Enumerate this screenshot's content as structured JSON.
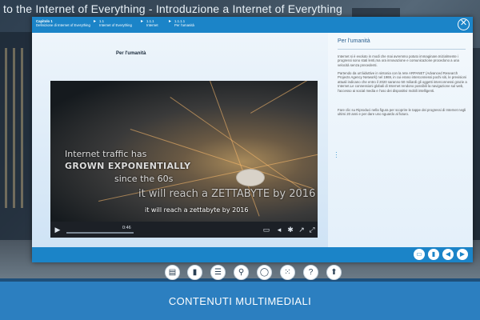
{
  "page": {
    "title": "to the Internet of Everything - Introduzione a Internet of Everything"
  },
  "breadcrumb": [
    {
      "line1": "Capitolo 1",
      "line2": "Definizione di Internet of Everything"
    },
    {
      "line1": "1.1",
      "line2": "Internet of Everything"
    },
    {
      "line1": "1.1.1",
      "line2": "Internet"
    },
    {
      "line1": "1.1.1.1",
      "line2": "Per l'umanità"
    }
  ],
  "left": {
    "section_label": "Per l'umanità"
  },
  "video": {
    "overlay_line1": "Internet traffic has",
    "overlay_line2": "GROWN EXPONENTIALLY",
    "overlay_line3": "since the 60s",
    "overlay_line4": "it will reach a ZETTABYTE by 2016",
    "caption": "it will reach a zettabyte by 2016",
    "time": "0:46"
  },
  "right": {
    "title": "Per l'umanità",
    "paragraphs": [
      "Internet si è evoluto in modi che mai avremmo potuto immaginare.Inizialmente i progressi sono stati lenti,ma ora innovazione e comunicazione procedono a una velocità senza precedenti.",
      "Partendo da un'àiduttive in sintonia con la rete ARPANET (Advanced Research Projects Agency Network) nel 1969, in cui erano interconnessi pochi siti, le previsioni attuali indicano che entro il 2020 saranno 50 miliardi gli oggetti interconnessi grazie a Internet.Le connessioni globali di Internet rendono possibili la navigazione sul web, l'accesso ai social media e l'uso dei dispositivi mobili intelligenti.",
      "Fare clic su Riproduci nella figura per scoprire le tappe dei progressi di Internet negli ultimi 20 anni e per dare uno sguardo al futuro."
    ]
  },
  "toolbar_icons": [
    "book-icon",
    "bookmark-icon",
    "list-icon",
    "search-icon",
    "chat-icon",
    "grid-icon",
    "help-icon",
    "upload-icon"
  ],
  "banner": {
    "text": "CONTENUTI MULTIMEDIALI"
  },
  "colors": {
    "accent": "#1b84c8",
    "banner": "#2c7fc0"
  }
}
